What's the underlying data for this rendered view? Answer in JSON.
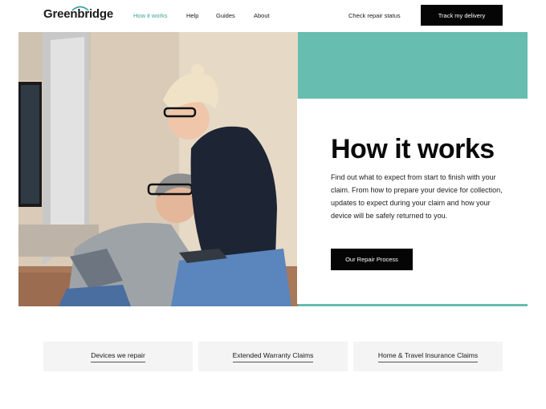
{
  "header": {
    "logo": "Greenbridge",
    "nav": [
      "How it works",
      "Help",
      "Guides",
      "About"
    ],
    "check_status": "Check repair status",
    "track_button": "Track my delivery"
  },
  "hero": {
    "title": "How it works",
    "body": "Find out what to expect from start to finish with your claim. From how to prepare your device for collection, updates to expect during your claim and how your device will be safely returned to you.",
    "button": "Our Repair Process"
  },
  "categories": [
    "Devices we repair",
    "Extended Warranty Claims",
    "Home & Travel Insurance Claims"
  ],
  "colors": {
    "accent": "#67bdaf",
    "active_nav": "#3aa59a",
    "button": "#050505"
  }
}
